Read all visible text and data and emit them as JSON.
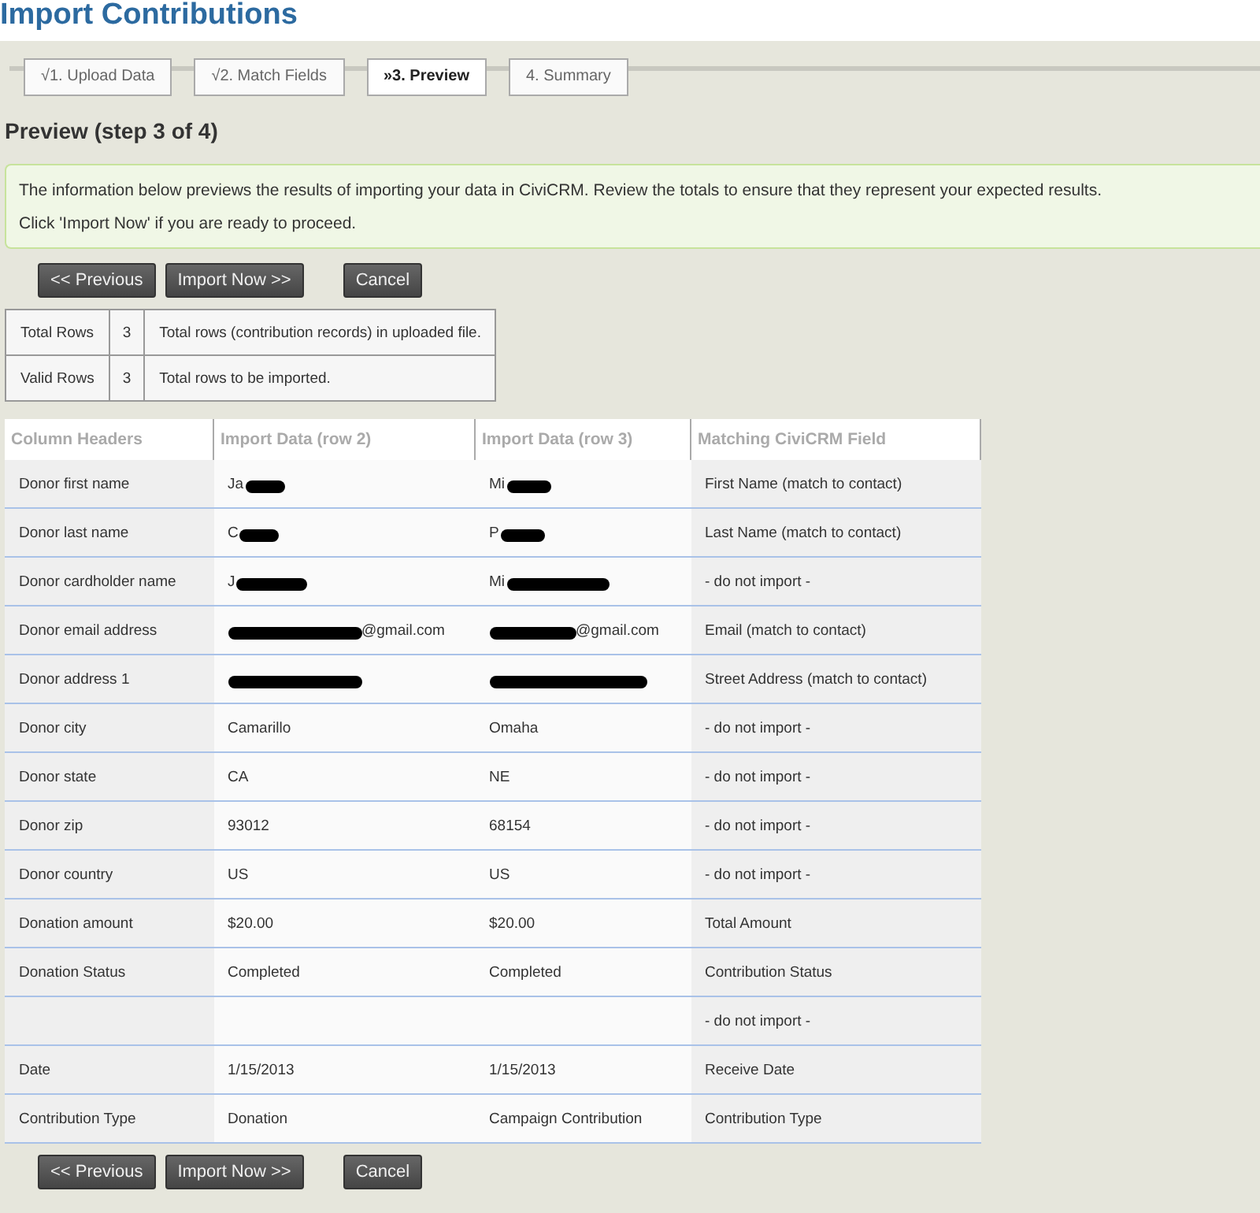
{
  "page_title": "Import Contributions",
  "tabs": [
    {
      "label": "√1. Upload Data",
      "selected": false
    },
    {
      "label": "√2. Match Fields",
      "selected": false
    },
    {
      "label": "»3. Preview",
      "selected": true
    },
    {
      "label": "4. Summary",
      "selected": false
    }
  ],
  "heading": "Preview (step 3 of 4)",
  "message": [
    "The information below previews the results of importing your data in CiviCRM. Review the totals to ensure that they represent your expected results.",
    "Click 'Import Now' if you are ready to proceed."
  ],
  "buttons_top": [
    "<< Previous",
    "Import Now >>",
    "Cancel"
  ],
  "summary": [
    {
      "label": "Total Rows",
      "count": "3",
      "description": "Total rows (contribution records) in uploaded file."
    },
    {
      "label": "Valid Rows",
      "count": "3",
      "description": "Total rows to be imported."
    }
  ],
  "preview": {
    "columns": [
      "Column Headers",
      "Import Data (row 2)",
      "Import Data (row 3)",
      "Matching CiviCRM Field"
    ],
    "rows": [
      [
        {
          "text": "Donor first name"
        },
        {
          "text": "Ja",
          "redacted": true
        },
        {
          "text": "Mi",
          "redacted": true
        },
        {
          "text": "First Name (match to contact)"
        }
      ],
      [
        {
          "text": "Donor last name"
        },
        {
          "text": "C",
          "redacted": true
        },
        {
          "text": "P",
          "redacted": true
        },
        {
          "text": "Last Name (match to contact)"
        }
      ],
      [
        {
          "text": "Donor cardholder name"
        },
        {
          "text": "J",
          "redacted": true
        },
        {
          "text": "Mi",
          "redacted": true
        },
        {
          "text": "- do not import -"
        }
      ],
      [
        {
          "text": "Donor email address"
        },
        {
          "redacted": true,
          "after": "@gmail.com"
        },
        {
          "redacted": true,
          "after": "@gmail.com"
        },
        {
          "text": "Email (match to contact)"
        }
      ],
      [
        {
          "text": "Donor address 1"
        },
        {
          "redacted": true
        },
        {
          "redacted": true
        },
        {
          "text": "Street Address (match to contact)"
        }
      ],
      [
        {
          "text": "Donor city"
        },
        {
          "text": "Camarillo"
        },
        {
          "text": "Omaha"
        },
        {
          "text": "- do not import -"
        }
      ],
      [
        {
          "text": "Donor state"
        },
        {
          "text": "CA"
        },
        {
          "text": "NE"
        },
        {
          "text": "- do not import -"
        }
      ],
      [
        {
          "text": "Donor zip"
        },
        {
          "text": "93012"
        },
        {
          "text": "68154"
        },
        {
          "text": "- do not import -"
        }
      ],
      [
        {
          "text": "Donor country"
        },
        {
          "text": "US"
        },
        {
          "text": "US"
        },
        {
          "text": "- do not import -"
        }
      ],
      [
        {
          "text": "Donation amount"
        },
        {
          "text": "$20.00"
        },
        {
          "text": "$20.00"
        },
        {
          "text": "Total Amount"
        }
      ],
      [
        {
          "text": "Donation Status"
        },
        {
          "text": "Completed"
        },
        {
          "text": "Completed"
        },
        {
          "text": "Contribution Status"
        }
      ],
      [
        {},
        {},
        {},
        {
          "text": "- do not import -"
        }
      ],
      [
        {
          "text": "Date"
        },
        {
          "text": "1/15/2013"
        },
        {
          "text": "1/15/2013"
        },
        {
          "text": "Receive Date"
        }
      ],
      [
        {
          "text": "Contribution Type"
        },
        {
          "text": "Donation"
        },
        {
          "text": "Campaign Contribution"
        },
        {
          "text": "Contribution Type"
        }
      ]
    ]
  },
  "buttons_bottom": [
    "<< Previous",
    "Import Now >>",
    "Cancel"
  ]
}
